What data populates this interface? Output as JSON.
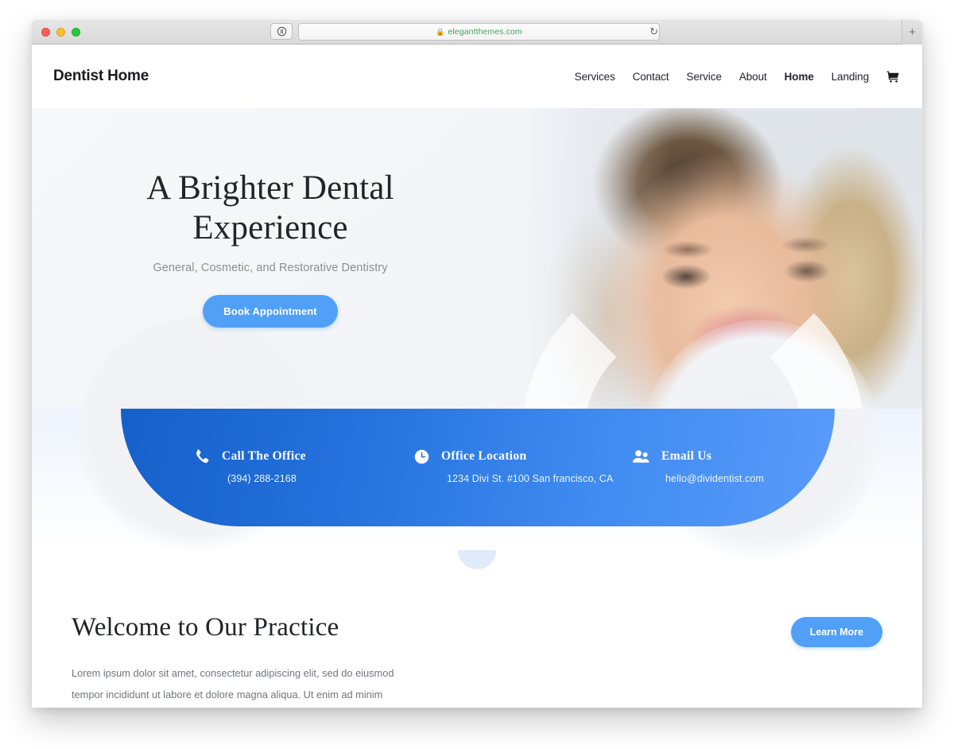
{
  "browser": {
    "url": "elegantthemes.com",
    "lock_icon": "lock-icon",
    "reload_icon": "reload-icon",
    "newtab_label": "+",
    "traffic_lights": [
      "close",
      "minimize",
      "zoom"
    ]
  },
  "site": {
    "brand": "Dentist Home",
    "nav": [
      {
        "label": "Services",
        "active": false
      },
      {
        "label": "Contact",
        "active": false
      },
      {
        "label": "Service",
        "active": false
      },
      {
        "label": "About",
        "active": false
      },
      {
        "label": "Home",
        "active": true
      },
      {
        "label": "Landing",
        "active": false
      }
    ],
    "cart_icon": "shopping-cart-icon"
  },
  "hero": {
    "title_line1": "A Brighter Dental",
    "title_line2": "Experience",
    "subtitle": "General, Cosmetic, and Restorative Dentistry",
    "cta_label": "Book Appointment"
  },
  "info_band": {
    "items": [
      {
        "icon": "phone-icon",
        "title": "Call The Office",
        "value": "(394) 288-2168"
      },
      {
        "icon": "clock-icon",
        "title": "Office Location",
        "value": "1234 Divi St. #100 San francisco, CA"
      },
      {
        "icon": "people-icon",
        "title": "Email Us",
        "value": "hello@dividentist.com"
      }
    ]
  },
  "welcome": {
    "title": "Welcome to Our Practice",
    "cta_label": "Learn More",
    "body_line1": "Lorem ipsum dolor sit amet, consectetur adipiscing elit, sed do eiusmod tempor incididunt ut",
    "body_line2": "labore et dolore magna aliqua. Ut enim ad minim veniam, quis nostrud exercitation ullamco"
  },
  "colors": {
    "accent_button": "#50a0f7",
    "band_left": "#1560c9",
    "band_right": "#5a9bfb",
    "text_dark": "#232429",
    "text_muted": "#8a8d94"
  }
}
